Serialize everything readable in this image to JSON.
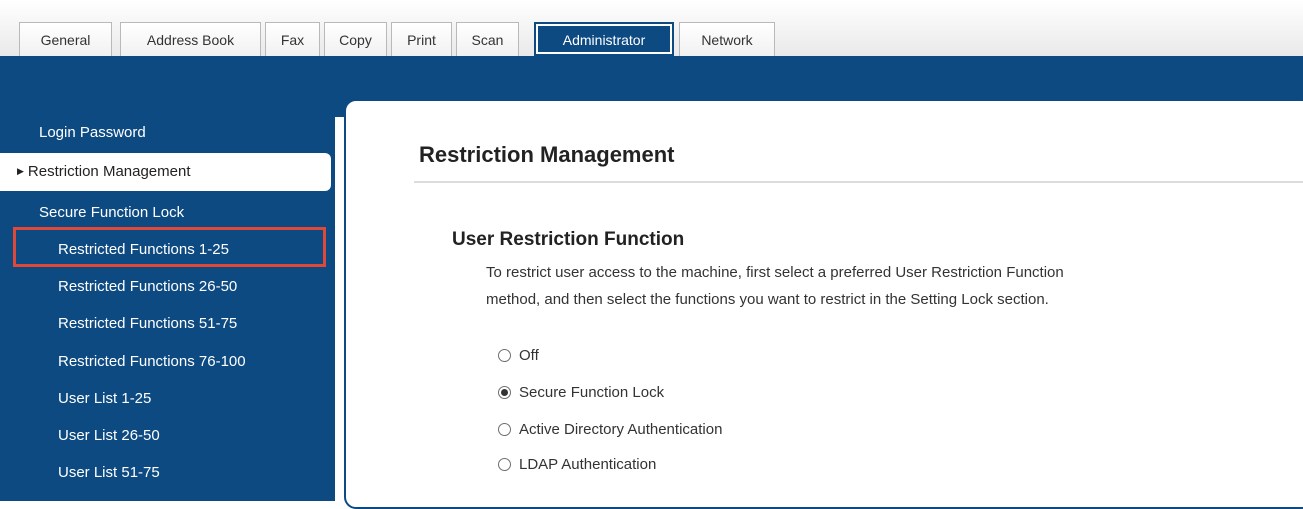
{
  "tabs": [
    {
      "label": "General",
      "active": false
    },
    {
      "label": "Address Book",
      "active": false
    },
    {
      "label": "Fax",
      "active": false
    },
    {
      "label": "Copy",
      "active": false
    },
    {
      "label": "Print",
      "active": false
    },
    {
      "label": "Scan",
      "active": false
    },
    {
      "label": "Administrator",
      "active": true
    },
    {
      "label": "Network",
      "active": false
    }
  ],
  "sidebar": {
    "items": [
      {
        "label": "Login Password"
      },
      {
        "label": "Restriction Management",
        "selected": true
      },
      {
        "label": "Secure Function Lock"
      },
      {
        "label": "Restricted Functions 1-25",
        "highlighted": true
      },
      {
        "label": "Restricted Functions 26-50"
      },
      {
        "label": "Restricted Functions 51-75"
      },
      {
        "label": "Restricted Functions 76-100"
      },
      {
        "label": "User List 1-25"
      },
      {
        "label": "User List 26-50"
      },
      {
        "label": "User List 51-75"
      }
    ],
    "selected_marker": "triangle-right-icon"
  },
  "main": {
    "title": "Restriction Management",
    "section": {
      "title": "User Restriction Function",
      "description_line1": "To restrict user access to the machine, first select a preferred User Restriction Function",
      "description_line2": "method, and then select the functions you want to restrict in the Setting Lock section.",
      "options": [
        {
          "label": "Off",
          "checked": false
        },
        {
          "label": "Secure Function Lock",
          "checked": true
        },
        {
          "label": "Active Directory Authentication",
          "checked": false
        },
        {
          "label": "LDAP Authentication",
          "checked": false
        }
      ]
    }
  },
  "colors": {
    "brand_blue": "#0d4a82",
    "highlight_red": "#e0493a"
  }
}
